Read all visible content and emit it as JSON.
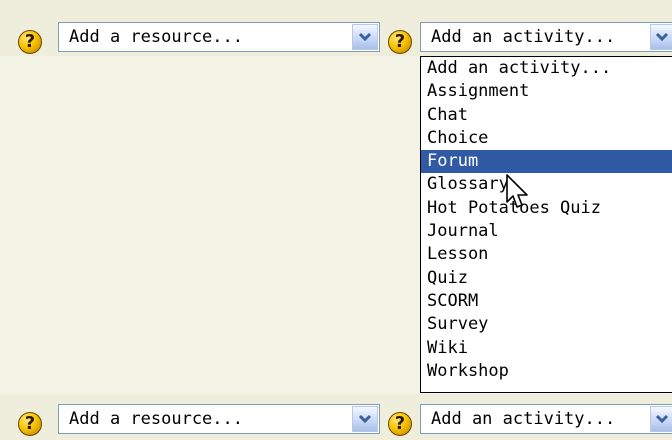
{
  "top_row": {
    "resource_select": {
      "selected": "Add a resource..."
    },
    "activity_select": {
      "selected": "Add an activity..."
    },
    "help_icon": "?"
  },
  "activity_dropdown": {
    "options": [
      "Add an activity...",
      "Assignment",
      "Chat",
      "Choice",
      "Forum",
      "Glossary",
      "Hot Potatoes Quiz",
      "Journal",
      "Lesson",
      "Quiz",
      "SCORM",
      "Survey",
      "Wiki",
      "Workshop"
    ],
    "highlighted_option": "Forum",
    "highlight_color": "#315aa5"
  },
  "bottom_row": {
    "resource_select": {
      "selected": "Add a resource..."
    },
    "activity_select": {
      "selected": "Add an activity..."
    },
    "help_icon": "?"
  },
  "icons": {
    "help": "help-icon",
    "dropdown": "chevron-down-icon",
    "pointer": "mouse-pointer-icon"
  }
}
